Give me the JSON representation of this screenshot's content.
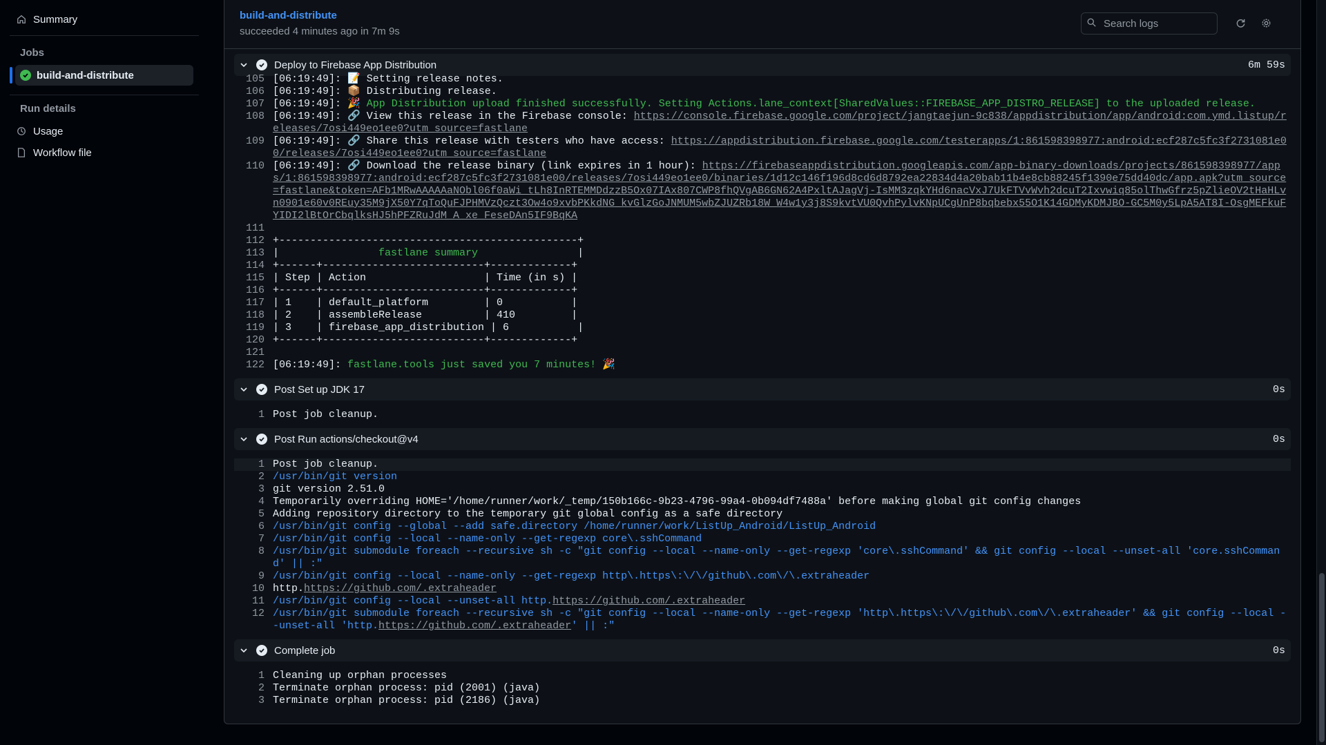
{
  "sidebar": {
    "summary": "Summary",
    "jobs_heading": "Jobs",
    "job": "build-and-distribute",
    "run_details_heading": "Run details",
    "usage": "Usage",
    "workflow_file": "Workflow file"
  },
  "header": {
    "title": "build-and-distribute",
    "subtitle": "succeeded 4 minutes ago in 7m 9s",
    "search_placeholder": "Search logs"
  },
  "steps": {
    "deploy": {
      "name": "Deploy to Firebase App Distribution",
      "duration": "6m 59s"
    },
    "post_jdk": {
      "name": "Post Set up JDK 17",
      "duration": "0s"
    },
    "post_checkout": {
      "name": "Post Run actions/checkout@v4",
      "duration": "0s"
    },
    "complete": {
      "name": "Complete job",
      "duration": "0s"
    }
  },
  "deploy_log": [
    {
      "n": "105",
      "t": "[06:19:49]: 📝 Setting release notes."
    },
    {
      "n": "106",
      "t": "[06:19:49]: 📦 Distributing release."
    },
    {
      "n": "107",
      "t": "[06:19:49]: ",
      "g": "🎉 App Distribution upload finished successfully. Setting Actions.lane_context[SharedValues::FIREBASE_APP_DISTRO_RELEASE] to the uploaded release."
    },
    {
      "n": "108",
      "t": "[06:19:49]: 🔗 View this release in the Firebase console: ",
      "u": "https://console.firebase.google.com/project/jangtaejun-9c838/appdistribution/app/android:com.ymd.listup/releases/7osi449eo1ee0?utm_source=fastlane"
    },
    {
      "n": "109",
      "t": "[06:19:49]: 🔗 Share this release with testers who have access: ",
      "u": "https://appdistribution.firebase.google.com/testerapps/1:861598398977:android:ecf287c5fc3f2731081e00/releases/7osi449eo1ee0?utm_source=fastlane"
    },
    {
      "n": "110",
      "t": "[06:19:49]: 🔗 Download the release binary (link expires in 1 hour): ",
      "u": "https://firebaseappdistribution.googleapis.com/app-binary-downloads/projects/861598398977/apps/1:861598398977:android:ecf287c5fc3f2731081e00/releases/7osi449eo1ee0/binaries/1d12c146f196d8cd6d8792ea22834d4a20bab11b4e8cb88245f1390e75dd40dc/app.apk?utm_source=fastlane&token=AFb1MRwAAAAAaNObl06f0aWi_tLh8InRTEMMDdzzB5Ox07IAx807CWP8fhQVgAB6GN62A4PxltAJagVj-IsMM3zqkYHd6nacVxJ7UkFTVvWvh2dcuT2Ixvwiq85olThwGfrz5pZlieOV2tHaHLvn0901e60v0REuy35M9jX50Y7qToQuFJPHMVzQczt3Ow4o9xvbPKkdNG_kvGlzGoJNMUM5wbZJUZRb18W_W4w1y3j8S9kvtVU0QvhPylvKNpUCgUnP8bqbebx55O1K14GDMyKDMJBO-GC5M0y5LpA5AT8I-OsgMEFkuFYIDI2lBtOrCbqlksHJ5hPFZRuJdM_A_xe_FeseDAn5IF9BqKA"
    },
    {
      "n": "111",
      "t": ""
    },
    {
      "n": "112",
      "t": "+------------------------------------------------+"
    },
    {
      "n": "113",
      "t": "|                ",
      "g": "fastlane summary",
      "t2": "                |"
    },
    {
      "n": "114",
      "t": "+------+--------------------------+-------------+"
    },
    {
      "n": "115",
      "t": "| Step | Action                   | Time (in s) |"
    },
    {
      "n": "116",
      "t": "+------+--------------------------+-------------+"
    },
    {
      "n": "117",
      "t": "| 1    | default_platform         | 0           |"
    },
    {
      "n": "118",
      "t": "| 2    | assembleRelease          | 410         |"
    },
    {
      "n": "119",
      "t": "| 3    | firebase_app_distribution | 6           |"
    },
    {
      "n": "120",
      "t": "+------+--------------------------+-------------+"
    },
    {
      "n": "121",
      "t": ""
    },
    {
      "n": "122",
      "t": "[06:19:49]: ",
      "g": "fastlane.tools just saved you 7 minutes! 🎉"
    }
  ],
  "post_jdk_log": [
    {
      "n": "1",
      "t": "Post job cleanup."
    }
  ],
  "checkout_log": [
    {
      "n": "1",
      "t": "Post job cleanup."
    },
    {
      "n": "2",
      "b": "/usr/bin/git version"
    },
    {
      "n": "3",
      "t": "git version 2.51.0"
    },
    {
      "n": "4",
      "t": "Temporarily overriding HOME='/home/runner/work/_temp/150b166c-9b23-4796-99a4-0b094df7488a' before making global git config changes"
    },
    {
      "n": "5",
      "t": "Adding repository directory to the temporary git global config as a safe directory"
    },
    {
      "n": "6",
      "b": "/usr/bin/git config --global --add safe.directory /home/runner/work/ListUp_Android/ListUp_Android"
    },
    {
      "n": "7",
      "b": "/usr/bin/git config --local --name-only --get-regexp core\\.sshCommand"
    },
    {
      "n": "8",
      "b": "/usr/bin/git submodule foreach --recursive sh -c \"git config --local --name-only --get-regexp 'core\\.sshCommand' && git config --local --unset-all 'core.sshCommand' || :\""
    },
    {
      "n": "9",
      "b": "/usr/bin/git config --local --name-only --get-regexp http\\.https\\:\\/\\/github\\.com\\/\\.extraheader"
    },
    {
      "n": "10",
      "t": "http.",
      "u": "https://github.com/.extraheader"
    },
    {
      "n": "11",
      "b": "/usr/bin/git config --local --unset-all http.",
      "u": "https://github.com/.extraheader"
    },
    {
      "n": "12",
      "b": "/usr/bin/git submodule foreach --recursive sh -c \"git config --local --name-only --get-regexp 'http\\.https\\:\\/\\/github\\.com\\/\\.extraheader' && git config --local --unset-all 'http.",
      "u": "https://github.com/.extraheader",
      "b2": "' || :\""
    }
  ],
  "complete_log": [
    {
      "n": "1",
      "t": "Cleaning up orphan processes"
    },
    {
      "n": "2",
      "t": "Terminate orphan process: pid (2001) (java)"
    },
    {
      "n": "3",
      "t": "Terminate orphan process: pid (2186) (java)"
    }
  ],
  "colors": {
    "accent": "#4493f8",
    "success": "#3fb950",
    "background": "#0d1117"
  },
  "icons": [
    "home-icon",
    "check-circle-icon",
    "clock-icon",
    "file-icon",
    "search-icon",
    "refresh-icon",
    "gear-icon",
    "chevron-down-icon"
  ]
}
